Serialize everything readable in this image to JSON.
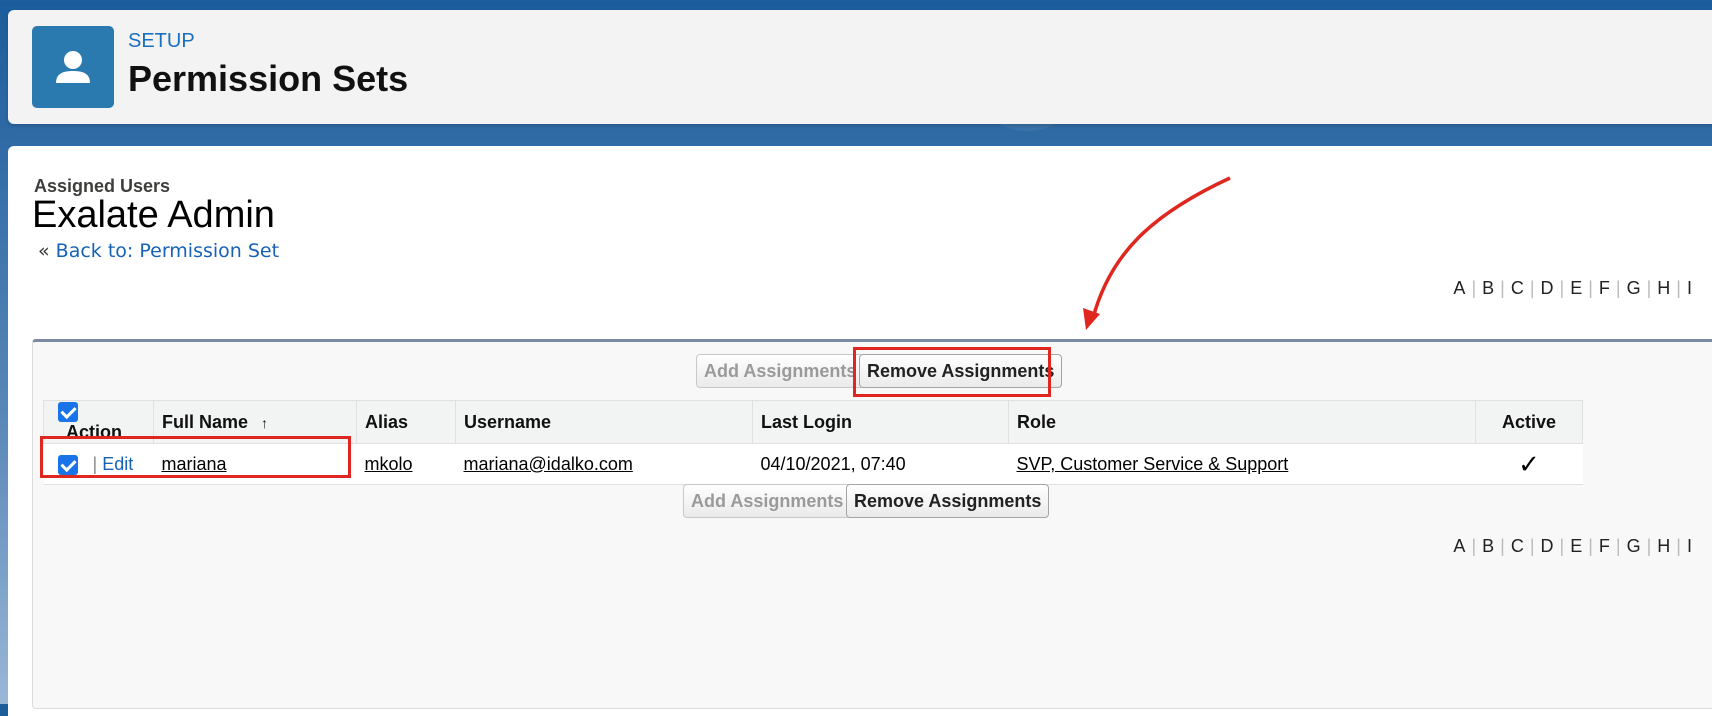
{
  "header": {
    "setup_label": "SETUP",
    "title": "Permission Sets",
    "icon": "user-icon"
  },
  "section": {
    "label": "Assigned Users",
    "record_name": "Exalate Admin",
    "back_prefix": "«",
    "back_link": "Back to: Permission Set"
  },
  "alpha_nav": [
    "A",
    "B",
    "C",
    "D",
    "E",
    "F",
    "G",
    "H",
    "I"
  ],
  "buttons": {
    "add": "Add Assignments",
    "remove": "Remove Assignments"
  },
  "table": {
    "columns": {
      "action": "Action",
      "full_name": "Full Name",
      "sort_indicator": "↑",
      "alias": "Alias",
      "username": "Username",
      "last_login": "Last Login",
      "role": "Role",
      "active": "Active"
    },
    "rows": [
      {
        "checked": true,
        "action_sep": "|",
        "edit": "Edit",
        "full_name": "mariana",
        "alias": "mkolo",
        "username": "mariana@idalko.com",
        "last_login": "04/10/2021, 07:40",
        "role": "SVP, Customer Service & Support",
        "active": "✓"
      }
    ]
  },
  "colors": {
    "accent": "#1662b5",
    "highlight": "#e0271f",
    "icon_bg": "#2a7ab0"
  }
}
